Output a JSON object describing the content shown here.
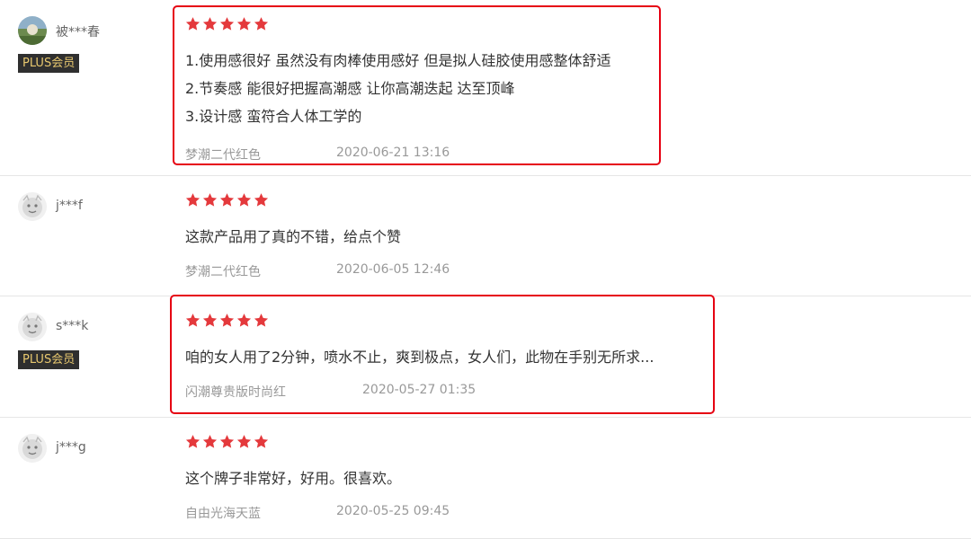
{
  "colors": {
    "star": "#e4393c",
    "highlight": "#e60012",
    "plus_text": "#e8c86f",
    "plus_bg": "#2f2f2f"
  },
  "reviews": [
    {
      "user": "被***春",
      "badge": "PLUS会员",
      "rating": 5,
      "lines": [
        "1.使用感很好 虽然没有肉棒使用感好 但是拟人硅胶使用感整体舒适",
        "2.节奏感 能很好把握高潮感 让你高潮迭起 达至顶峰",
        "3.设计感 蛮符合人体工学的"
      ],
      "variant": "梦潮二代红色",
      "date": "2020-06-21 13:16"
    },
    {
      "user": "j***f",
      "rating": 5,
      "lines": [
        "这款产品用了真的不错，给点个赞"
      ],
      "variant": "梦潮二代红色",
      "date": "2020-06-05 12:46"
    },
    {
      "user": "s***k",
      "badge": "PLUS会员",
      "rating": 5,
      "lines": [
        "咱的女人用了2分钟，喷水不止，爽到极点，女人们，此物在手别无所求..."
      ],
      "variant": "闪潮尊贵版时尚红",
      "date": "2020-05-27 01:35"
    },
    {
      "user": "j***g",
      "rating": 5,
      "lines": [
        "这个牌子非常好，好用。很喜欢。"
      ],
      "variant": "自由光海天蓝",
      "date": "2020-05-25 09:45"
    }
  ]
}
